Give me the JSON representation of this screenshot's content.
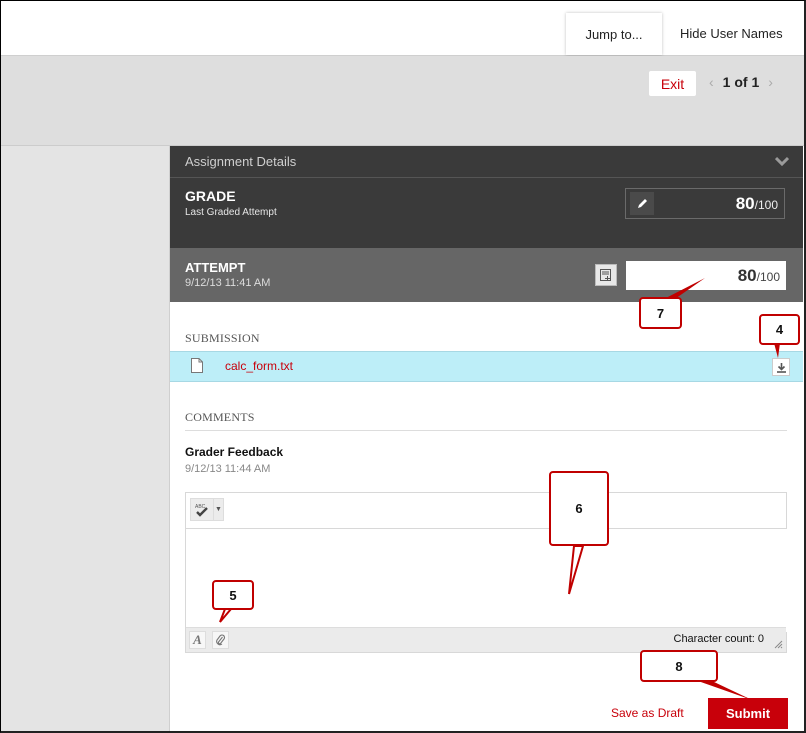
{
  "header": {
    "jump_label": "Jump to...",
    "hide_names_label": "Hide User Names"
  },
  "navbar": {
    "exit_label": "Exit",
    "prev_icon": "chevron-left-icon",
    "next_icon": "chevron-right-icon",
    "page_indicator": "1 of 1"
  },
  "panel": {
    "details_title": "Assignment Details",
    "grade": {
      "label": "GRADE",
      "sublabel": "Last Graded Attempt",
      "score": "80",
      "out_of": "/100"
    },
    "attempt": {
      "label": "ATTEMPT",
      "date": "9/12/13 11:41 AM",
      "score": "80",
      "out_of": "/100"
    },
    "submission": {
      "title": "SUBMISSION",
      "file_name": "calc_form.txt"
    },
    "comments": {
      "title": "COMMENTS",
      "feedback_title": "Grader Feedback",
      "feedback_date": "9/12/13 11:44 AM",
      "editor_value": "",
      "character_count": "Character count: 0"
    },
    "actions": {
      "save_draft_label": "Save as Draft",
      "submit_label": "Submit"
    }
  },
  "callouts": {
    "c4": "4",
    "c5": "5",
    "c6": "6",
    "c7": "7",
    "c8": "8"
  },
  "colors": {
    "accent_red": "#c8000a",
    "panel_dark": "#3a3a3a",
    "attempt_grey": "#666666",
    "submission_highlight": "#bdeef8",
    "callout_border": "#c00000"
  }
}
